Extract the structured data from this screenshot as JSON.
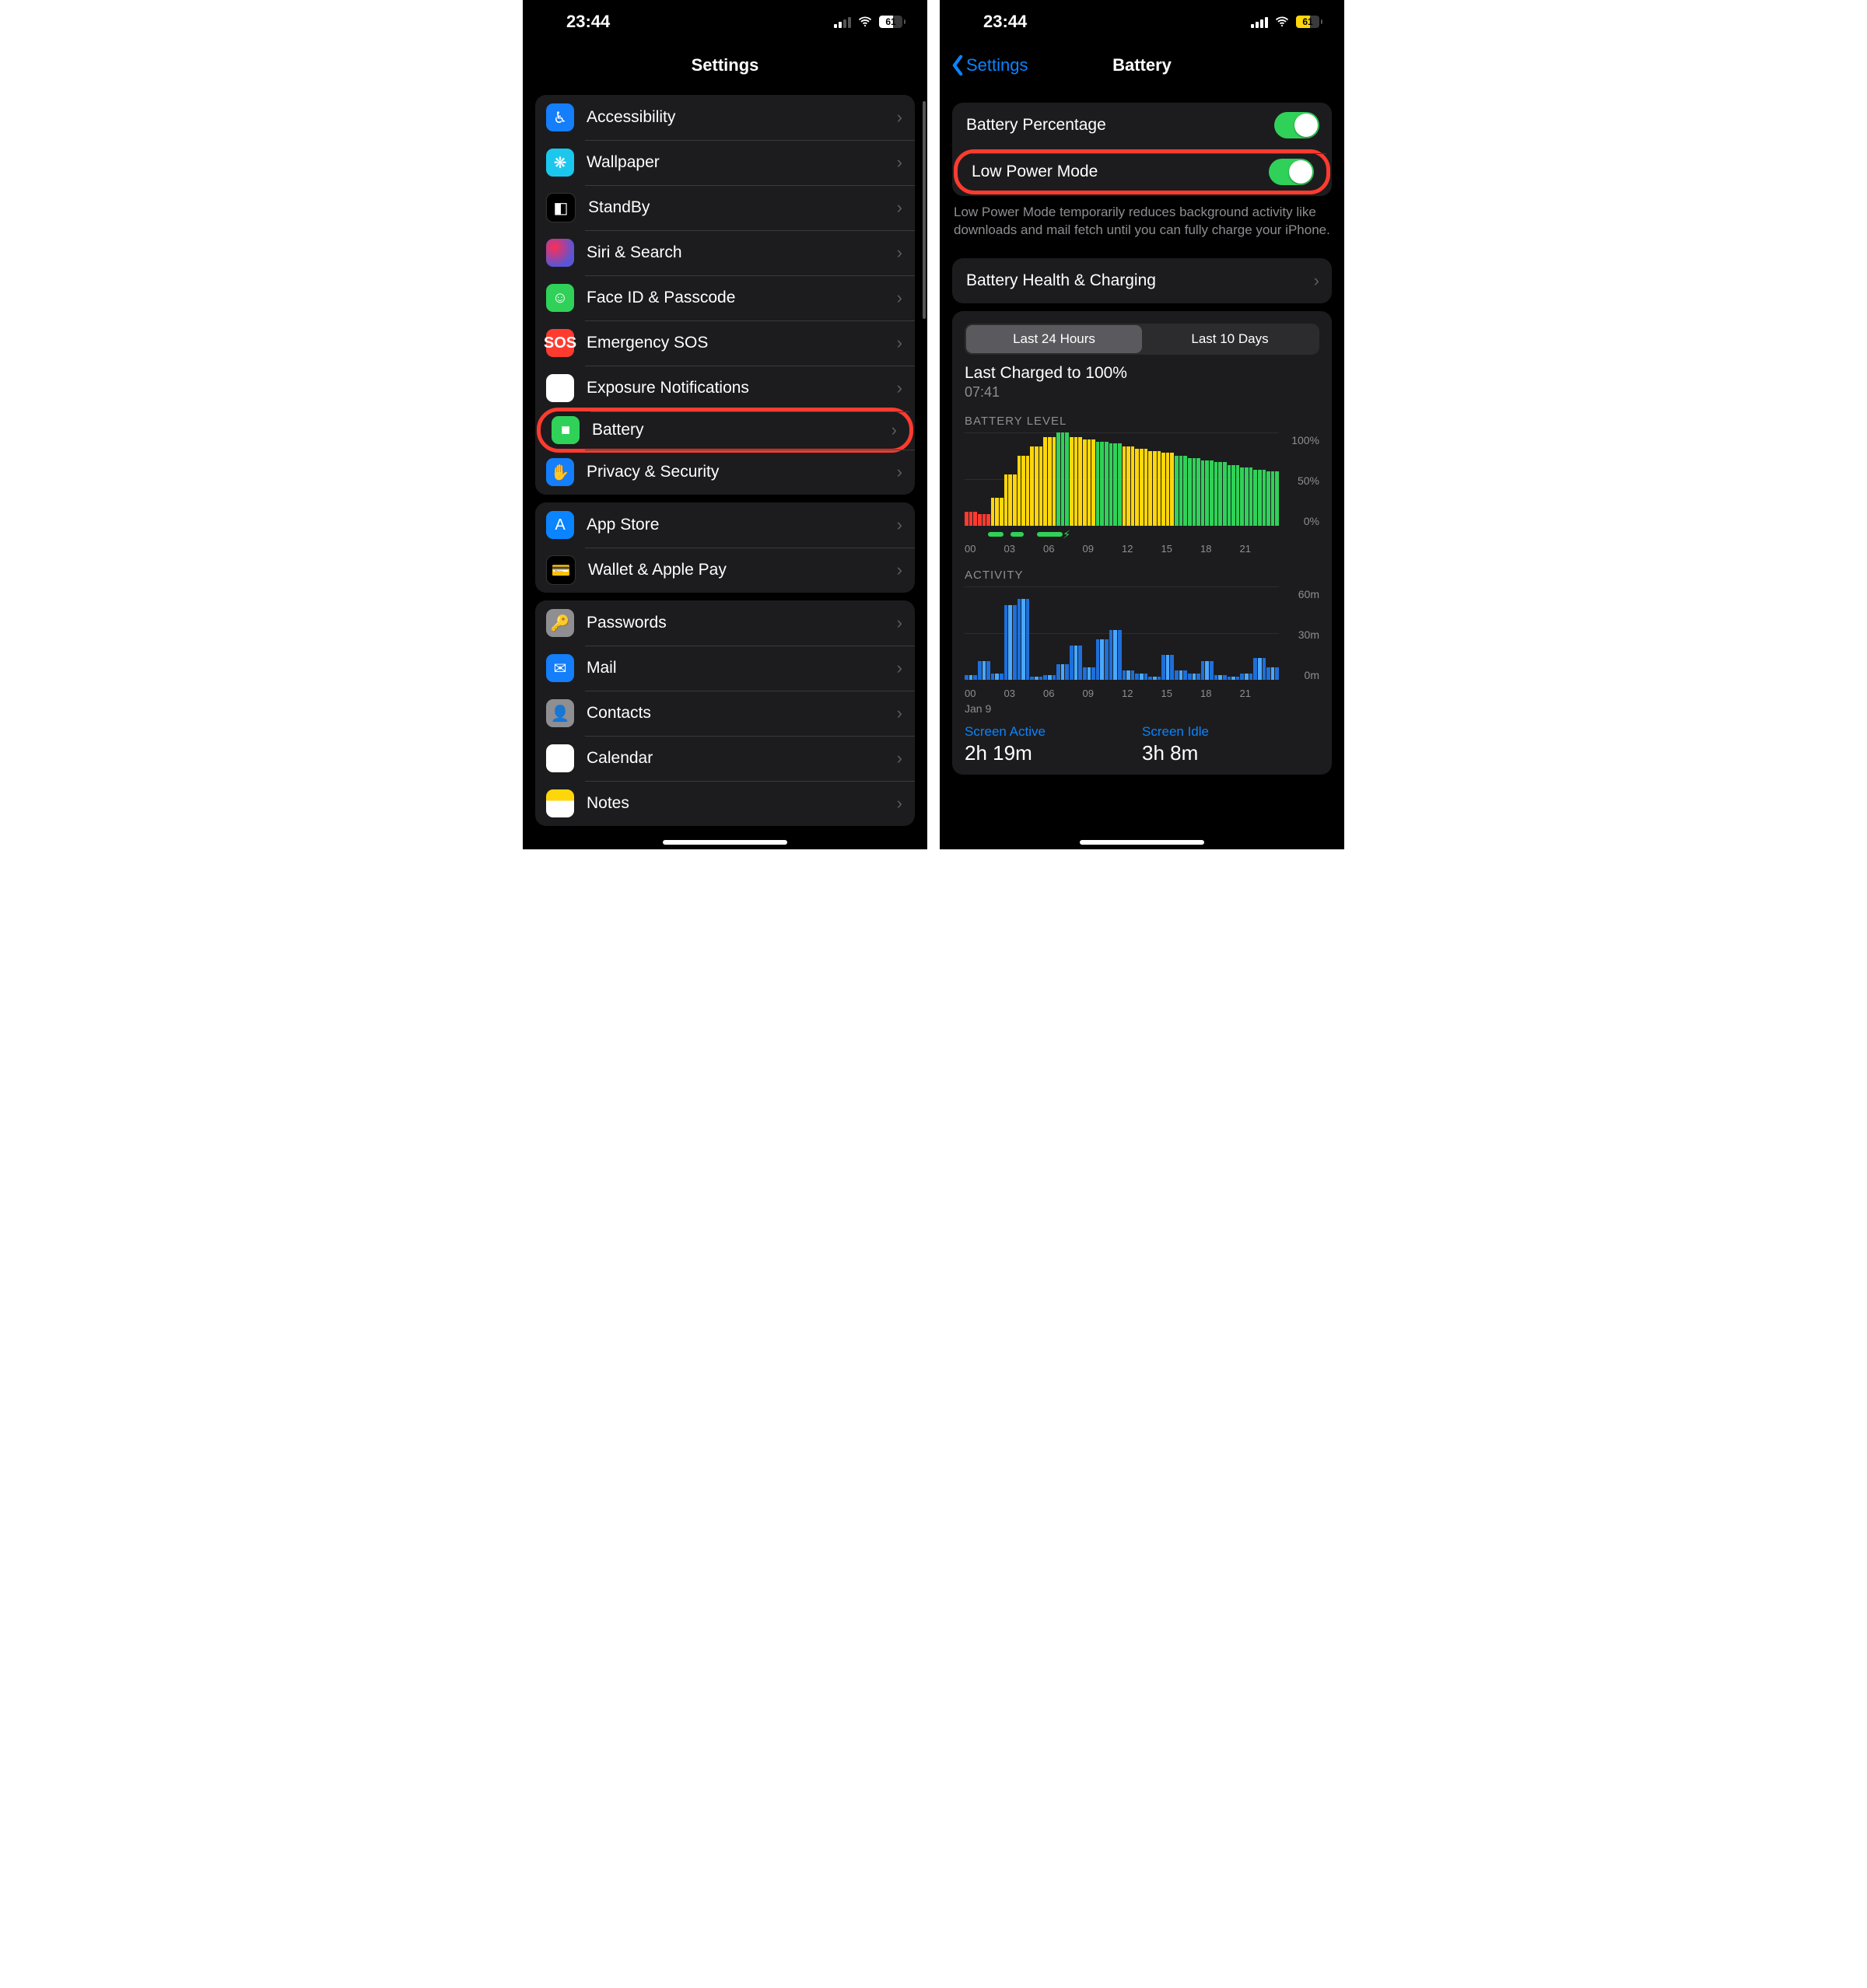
{
  "left": {
    "time": "23:44",
    "battery_pct": "61",
    "title": "Settings",
    "groups": [
      {
        "items": [
          {
            "key": "accessibility",
            "label": "Accessibility",
            "iconClass": "ic-access",
            "glyph": "♿︎"
          },
          {
            "key": "wallpaper",
            "label": "Wallpaper",
            "iconClass": "ic-wall",
            "glyph": "❋"
          },
          {
            "key": "standby",
            "label": "StandBy",
            "iconClass": "ic-standby",
            "glyph": "◧"
          },
          {
            "key": "siri",
            "label": "Siri & Search",
            "iconClass": "ic-siri",
            "glyph": ""
          },
          {
            "key": "faceid",
            "label": "Face ID & Passcode",
            "iconClass": "ic-faceid",
            "glyph": "☺︎"
          },
          {
            "key": "sos",
            "label": "Emergency SOS",
            "iconClass": "ic-sos",
            "glyph": "SOS"
          },
          {
            "key": "exposure",
            "label": "Exposure Notifications",
            "iconClass": "ic-exposure",
            "glyph": "☀︎"
          },
          {
            "key": "battery",
            "label": "Battery",
            "iconClass": "ic-battery",
            "glyph": "■",
            "highlight": true
          },
          {
            "key": "privacy",
            "label": "Privacy & Security",
            "iconClass": "ic-privacy",
            "glyph": "✋"
          }
        ]
      },
      {
        "items": [
          {
            "key": "appstore",
            "label": "App Store",
            "iconClass": "ic-appstore",
            "glyph": "A"
          },
          {
            "key": "wallet",
            "label": "Wallet & Apple Pay",
            "iconClass": "ic-wallet",
            "glyph": "💳"
          }
        ]
      },
      {
        "items": [
          {
            "key": "passwords",
            "label": "Passwords",
            "iconClass": "ic-passwords",
            "glyph": "🔑"
          },
          {
            "key": "mail",
            "label": "Mail",
            "iconClass": "ic-mail",
            "glyph": "✉︎"
          },
          {
            "key": "contacts",
            "label": "Contacts",
            "iconClass": "ic-contacts",
            "glyph": "👤"
          },
          {
            "key": "calendar",
            "label": "Calendar",
            "iconClass": "ic-calendar",
            "glyph": "▦"
          },
          {
            "key": "notes",
            "label": "Notes",
            "iconClass": "ic-notes",
            "glyph": ""
          }
        ]
      }
    ]
  },
  "right": {
    "time": "23:44",
    "battery_pct": "61",
    "back_label": "Settings",
    "title": "Battery",
    "toggles": {
      "percentage_label": "Battery Percentage",
      "lowpower_label": "Low Power Mode",
      "percentage_on": true,
      "lowpower_on": true,
      "highlight_lowpower": true
    },
    "lowpower_footer": "Low Power Mode temporarily reduces background activity like downloads and mail fetch until you can fully charge your iPhone.",
    "health_label": "Battery Health & Charging",
    "segmented": {
      "a": "Last 24 Hours",
      "b": "Last 10 Days",
      "selected": "a"
    },
    "charged": {
      "title": "Last Charged to 100%",
      "time": "07:41"
    },
    "level_title": "BATTERY LEVEL",
    "activity_title": "ACTIVITY",
    "level_ylabels": [
      "100%",
      "50%",
      "0%"
    ],
    "activity_ylabels": [
      "60m",
      "30m",
      "0m"
    ],
    "xticks": [
      "00",
      "03",
      "06",
      "09",
      "12",
      "15",
      "18",
      "21"
    ],
    "date_label": "Jan 9",
    "summary": {
      "active_label": "Screen Active",
      "active_value": "2h 19m",
      "idle_label": "Screen Idle",
      "idle_value": "3h 8m"
    }
  },
  "chart_data": {
    "battery_level": {
      "type": "bar",
      "title": "BATTERY LEVEL",
      "xlabel": "hour",
      "ylabel": "%",
      "ylim": [
        0,
        100
      ],
      "x_hours": [
        0,
        1,
        2,
        3,
        4,
        5,
        6,
        7,
        8,
        9,
        10,
        11,
        12,
        13,
        14,
        15,
        16,
        17,
        18,
        19,
        20,
        21,
        22,
        23
      ],
      "values": [
        15,
        12,
        30,
        55,
        75,
        85,
        95,
        100,
        95,
        92,
        90,
        88,
        85,
        82,
        80,
        78,
        75,
        72,
        70,
        68,
        65,
        62,
        60,
        58
      ],
      "color_state": [
        "red",
        "red",
        "yellow",
        "yellow",
        "yellow",
        "yellow",
        "yellow",
        "green",
        "yellow",
        "yellow",
        "green",
        "green",
        "yellow",
        "yellow",
        "yellow",
        "yellow",
        "green",
        "green",
        "green",
        "green",
        "green",
        "green",
        "green",
        "green"
      ],
      "charging_segments_hours": [
        [
          1.8,
          3.0
        ],
        [
          3.5,
          4.5
        ],
        [
          5.5,
          7.5
        ]
      ]
    },
    "activity": {
      "type": "bar",
      "title": "ACTIVITY",
      "xlabel": "hour",
      "ylabel": "minutes",
      "ylim": [
        0,
        60
      ],
      "x_hours": [
        0,
        1,
        2,
        3,
        4,
        5,
        6,
        7,
        8,
        9,
        10,
        11,
        12,
        13,
        14,
        15,
        16,
        17,
        18,
        19,
        20,
        21,
        22,
        23
      ],
      "values": [
        3,
        12,
        4,
        48,
        52,
        2,
        3,
        10,
        22,
        8,
        26,
        32,
        6,
        4,
        2,
        16,
        6,
        4,
        12,
        3,
        2,
        4,
        14,
        8
      ]
    }
  }
}
